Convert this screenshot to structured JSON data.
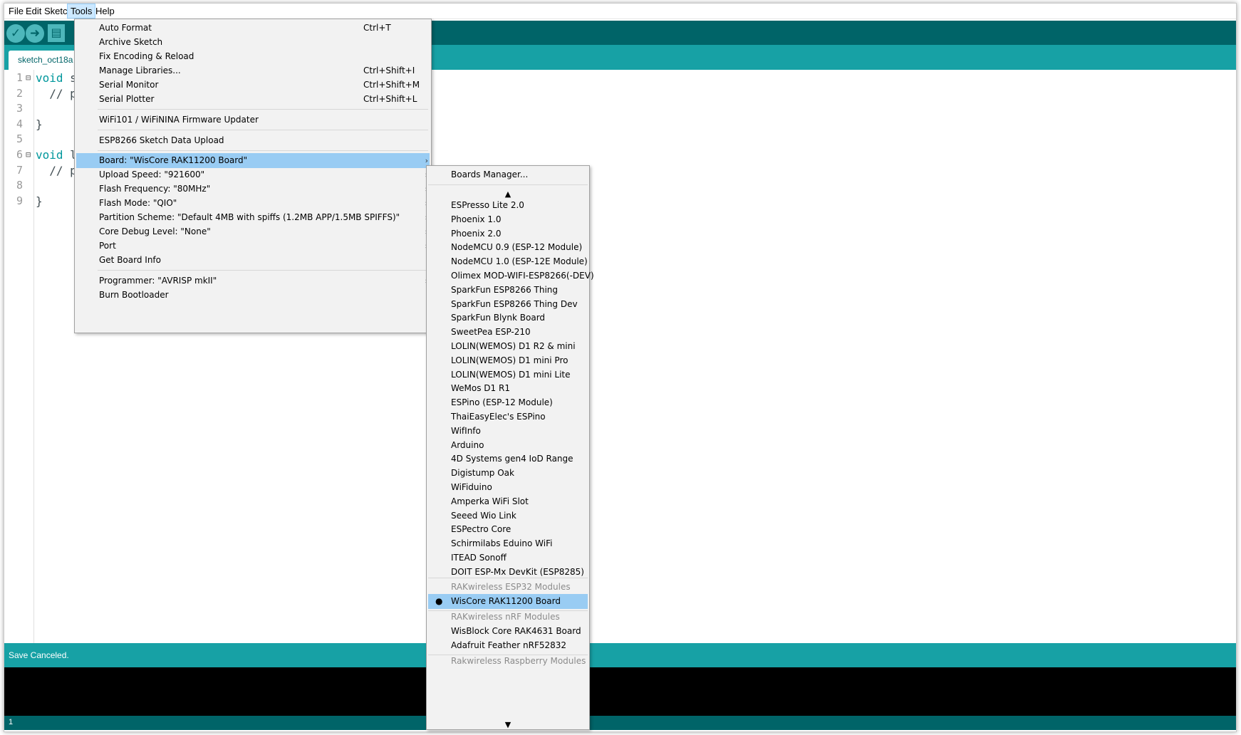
{
  "menubar": {
    "items": [
      "File",
      "Edit",
      "Sketch",
      "Tools",
      "Help"
    ],
    "active": "Tools"
  },
  "toolbar": {
    "verify_icon": "check-icon",
    "upload_icon": "arrow-right-icon",
    "new_icon": "new-file-icon"
  },
  "tab": {
    "label": "sketch_oct18a"
  },
  "editor": {
    "line_numbers": [
      "1",
      "2",
      "3",
      "4",
      "5",
      "6",
      "7",
      "8",
      "9"
    ],
    "lines": [
      {
        "kw": "void",
        "rest": " s"
      },
      {
        "kw": "",
        "rest": "  // p"
      },
      {
        "kw": "",
        "rest": ""
      },
      {
        "kw": "",
        "rest": "}"
      },
      {
        "kw": "",
        "rest": ""
      },
      {
        "kw": "void",
        "rest": " l"
      },
      {
        "kw": "",
        "rest": "  // p"
      },
      {
        "kw": "",
        "rest": ""
      },
      {
        "kw": "",
        "rest": "}"
      }
    ]
  },
  "status": {
    "message": "Save Canceled."
  },
  "footer": {
    "line": "1"
  },
  "tools_menu": {
    "items": [
      {
        "label": "Auto Format",
        "shortcut": "Ctrl+T"
      },
      {
        "label": "Archive Sketch",
        "shortcut": ""
      },
      {
        "label": "Fix Encoding & Reload",
        "shortcut": ""
      },
      {
        "label": "Manage Libraries...",
        "shortcut": "Ctrl+Shift+I"
      },
      {
        "label": "Serial Monitor",
        "shortcut": "Ctrl+Shift+M"
      },
      {
        "label": "Serial Plotter",
        "shortcut": "Ctrl+Shift+L"
      },
      {
        "label": "WiFi101 / WiFiNINA Firmware Updater",
        "shortcut": ""
      },
      {
        "label": "ESP8266 Sketch Data Upload",
        "shortcut": ""
      },
      {
        "label": "Board: \"WisCore RAK11200 Board\"",
        "shortcut": ""
      },
      {
        "label": "Upload Speed: \"921600\"",
        "shortcut": ""
      },
      {
        "label": "Flash Frequency: \"80MHz\"",
        "shortcut": ""
      },
      {
        "label": "Flash Mode: \"QIO\"",
        "shortcut": ""
      },
      {
        "label": "Partition Scheme: \"Default 4MB with spiffs (1.2MB APP/1.5MB SPIFFS)\"",
        "shortcut": ""
      },
      {
        "label": "Core Debug Level: \"None\"",
        "shortcut": ""
      },
      {
        "label": "Port",
        "shortcut": ""
      },
      {
        "label": "Get Board Info",
        "shortcut": ""
      },
      {
        "label": "Programmer: \"AVRISP mkII\"",
        "shortcut": ""
      },
      {
        "label": "Burn Bootloader",
        "shortcut": ""
      }
    ]
  },
  "board_menu": {
    "manager": "Boards Manager...",
    "boards": [
      "ESPresso Lite 2.0",
      "Phoenix 1.0",
      "Phoenix 2.0",
      "NodeMCU 0.9 (ESP-12 Module)",
      "NodeMCU 1.0 (ESP-12E Module)",
      "Olimex MOD-WIFI-ESP8266(-DEV)",
      "SparkFun ESP8266 Thing",
      "SparkFun ESP8266 Thing Dev",
      "SparkFun Blynk Board",
      "SweetPea ESP-210",
      "LOLIN(WEMOS) D1 R2 & mini",
      "LOLIN(WEMOS) D1 mini Pro",
      "LOLIN(WEMOS) D1 mini Lite",
      "WeMos D1 R1",
      "ESPino (ESP-12 Module)",
      "ThaiEasyElec's ESPino",
      "WifInfo",
      "Arduino",
      "4D Systems gen4 IoD Range",
      "Digistump Oak",
      "WiFiduino",
      "Amperka WiFi Slot",
      "Seeed Wio Link",
      "ESPectro Core",
      "Schirmilabs Eduino WiFi",
      "ITEAD Sonoff",
      "DOIT ESP-Mx DevKit (ESP8285)"
    ],
    "group_esp32": "RAKwireless ESP32 Modules",
    "selected_board": "WisCore RAK11200 Board",
    "group_nrf": "RAKwireless nRF Modules",
    "nrf_boards": [
      "WisBlock Core RAK4631 Board",
      "Adafruit Feather nRF52832"
    ],
    "group_rp": "Rakwireless Raspberry Modules"
  }
}
